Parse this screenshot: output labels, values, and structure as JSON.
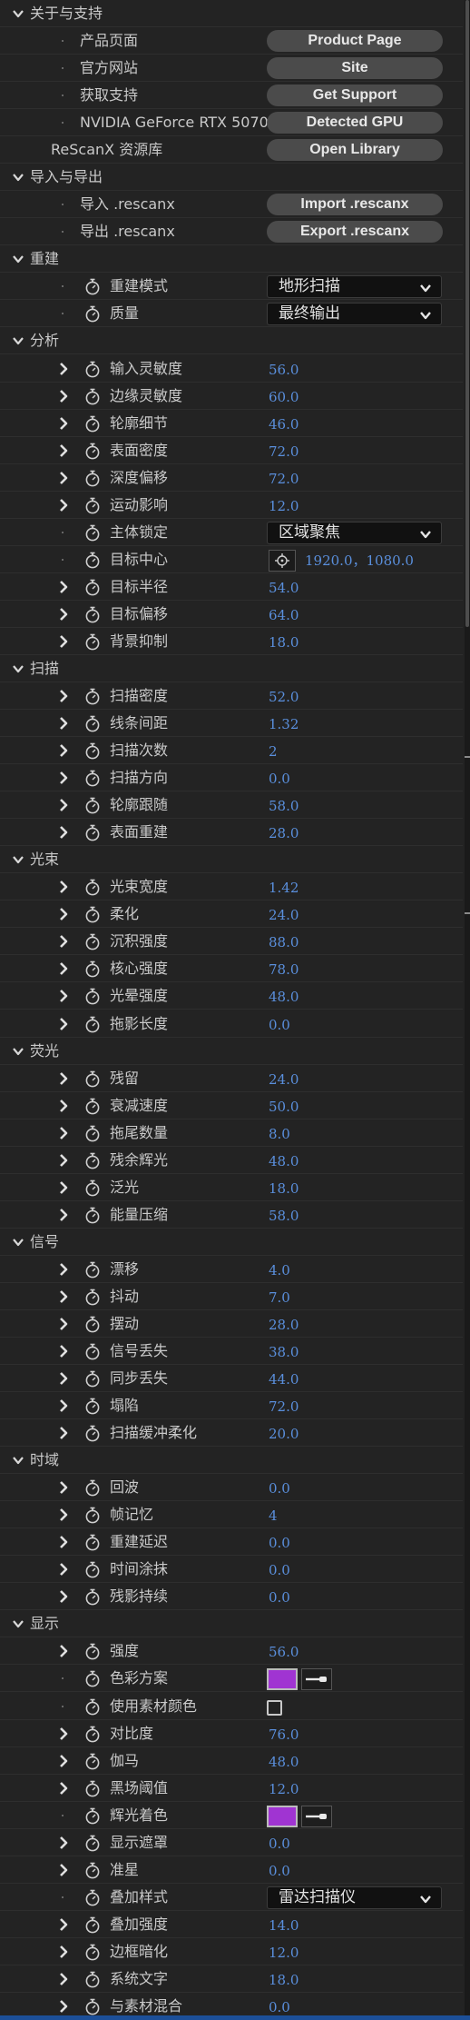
{
  "colors": {
    "background": "#232323",
    "value_blue": "#5a8fdc",
    "swatch_purple": "#a034d2",
    "button_gray": "#4b4b4b"
  },
  "icons": {
    "twirl": "chevron-down-icon",
    "expand": "chevron-right-icon",
    "keyframe": "stopwatch-icon",
    "target": "crosshair-icon",
    "eyedropper": "eyedropper-icon"
  },
  "rows": [
    {
      "type": "section",
      "label": "关于与支持"
    },
    {
      "type": "link",
      "label": "产品页面",
      "button": "Product Page"
    },
    {
      "type": "link",
      "label": "官方网站",
      "button": "Site"
    },
    {
      "type": "link",
      "label": "获取支持",
      "button": "Get Support"
    },
    {
      "type": "link",
      "label": "NVIDIA GeForce RTX 5070",
      "button": "Detected GPU"
    },
    {
      "type": "link0",
      "label": "ReScanX 资源库",
      "button": "Open Library"
    },
    {
      "type": "section",
      "label": "导入与导出"
    },
    {
      "type": "link",
      "label": "导入 .rescanx",
      "button": "Import .rescanx"
    },
    {
      "type": "link",
      "label": "导出 .rescanx",
      "button": "Export .rescanx"
    },
    {
      "type": "section",
      "label": "重建"
    },
    {
      "type": "dropdown",
      "label": "重建模式",
      "value": "地形扫描"
    },
    {
      "type": "dropdown",
      "label": "质量",
      "value": "最终输出"
    },
    {
      "type": "section",
      "label": "分析"
    },
    {
      "type": "param",
      "label": "输入灵敏度",
      "value": "56.0"
    },
    {
      "type": "param",
      "label": "边缘灵敏度",
      "value": "60.0"
    },
    {
      "type": "param",
      "label": "轮廓细节",
      "value": "46.0"
    },
    {
      "type": "param",
      "label": "表面密度",
      "value": "72.0"
    },
    {
      "type": "param",
      "label": "深度偏移",
      "value": "72.0"
    },
    {
      "type": "param",
      "label": "运动影响",
      "value": "12.0"
    },
    {
      "type": "dropdown",
      "label": "主体锁定",
      "value": "区域聚焦"
    },
    {
      "type": "point",
      "label": "目标中心",
      "value": "1920.0，1080.0"
    },
    {
      "type": "param",
      "label": "目标半径",
      "value": "54.0"
    },
    {
      "type": "param",
      "label": "目标偏移",
      "value": "64.0"
    },
    {
      "type": "param",
      "label": "背景抑制",
      "value": "18.0"
    },
    {
      "type": "section",
      "label": "扫描"
    },
    {
      "type": "param",
      "label": "扫描密度",
      "value": "52.0"
    },
    {
      "type": "param",
      "label": "线条间距",
      "value": "1.32"
    },
    {
      "type": "param",
      "label": "扫描次数",
      "value": "2"
    },
    {
      "type": "param",
      "label": "扫描方向",
      "value": "0.0"
    },
    {
      "type": "param",
      "label": "轮廓跟随",
      "value": "58.0"
    },
    {
      "type": "param",
      "label": "表面重建",
      "value": "28.0"
    },
    {
      "type": "section",
      "label": "光束"
    },
    {
      "type": "param",
      "label": "光束宽度",
      "value": "1.42"
    },
    {
      "type": "param",
      "label": "柔化",
      "value": "24.0"
    },
    {
      "type": "param",
      "label": "沉积强度",
      "value": "88.0"
    },
    {
      "type": "param",
      "label": "核心强度",
      "value": "78.0"
    },
    {
      "type": "param",
      "label": "光晕强度",
      "value": "48.0"
    },
    {
      "type": "param",
      "label": "拖影长度",
      "value": "0.0"
    },
    {
      "type": "section",
      "label": "荧光"
    },
    {
      "type": "param",
      "label": "残留",
      "value": "24.0"
    },
    {
      "type": "param",
      "label": "衰减速度",
      "value": "50.0"
    },
    {
      "type": "param",
      "label": "拖尾数量",
      "value": "8.0"
    },
    {
      "type": "param",
      "label": "残余辉光",
      "value": "48.0"
    },
    {
      "type": "param",
      "label": "泛光",
      "value": "18.0"
    },
    {
      "type": "param",
      "label": "能量压缩",
      "value": "58.0"
    },
    {
      "type": "section",
      "label": "信号"
    },
    {
      "type": "param",
      "label": "漂移",
      "value": "4.0"
    },
    {
      "type": "param",
      "label": "抖动",
      "value": "7.0"
    },
    {
      "type": "param",
      "label": "摆动",
      "value": "28.0"
    },
    {
      "type": "param",
      "label": "信号丢失",
      "value": "38.0"
    },
    {
      "type": "param",
      "label": "同步丢失",
      "value": "44.0"
    },
    {
      "type": "param",
      "label": "塌陷",
      "value": "72.0"
    },
    {
      "type": "param",
      "label": "扫描缓冲柔化",
      "value": "20.0"
    },
    {
      "type": "section",
      "label": "时域"
    },
    {
      "type": "param",
      "label": "回波",
      "value": "0.0"
    },
    {
      "type": "param",
      "label": "帧记忆",
      "value": "4"
    },
    {
      "type": "param",
      "label": "重建延迟",
      "value": "0.0"
    },
    {
      "type": "param",
      "label": "时间涂抹",
      "value": "0.0"
    },
    {
      "type": "param",
      "label": "残影持续",
      "value": "0.0"
    },
    {
      "type": "section",
      "label": "显示"
    },
    {
      "type": "param",
      "label": "强度",
      "value": "56.0"
    },
    {
      "type": "color",
      "label": "色彩方案",
      "value": "#a034d2"
    },
    {
      "type": "checkbox",
      "label": "使用素材颜色",
      "checked": false
    },
    {
      "type": "param",
      "label": "对比度",
      "value": "76.0"
    },
    {
      "type": "param",
      "label": "伽马",
      "value": "48.0"
    },
    {
      "type": "param",
      "label": "黑场阈值",
      "value": "12.0"
    },
    {
      "type": "color",
      "label": "辉光着色",
      "value": "#a034d2"
    },
    {
      "type": "param",
      "label": "显示遮罩",
      "value": "0.0"
    },
    {
      "type": "param",
      "label": "准星",
      "value": "0.0"
    },
    {
      "type": "dropdown",
      "label": "叠加样式",
      "value": "雷达扫描仪"
    },
    {
      "type": "param",
      "label": "叠加强度",
      "value": "14.0"
    },
    {
      "type": "param",
      "label": "边框暗化",
      "value": "12.0"
    },
    {
      "type": "param",
      "label": "系统文字",
      "value": "18.0"
    },
    {
      "type": "param",
      "label": "与素材混合",
      "value": "0.0"
    }
  ]
}
